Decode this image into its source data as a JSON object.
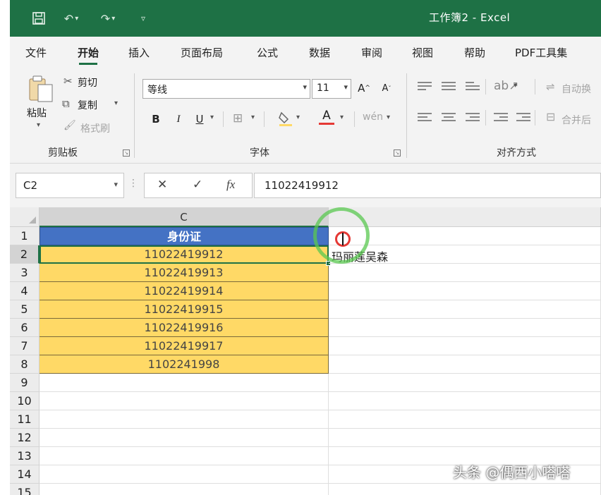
{
  "titlebar": {
    "title": "工作簿2 - Excel",
    "save_icon": "save-icon",
    "undo_icon": "undo-icon",
    "redo_icon": "redo-icon",
    "customize_icon": "customize-qat-icon"
  },
  "menu": {
    "tabs": [
      "文件",
      "开始",
      "插入",
      "页面布局",
      "公式",
      "数据",
      "审阅",
      "视图",
      "帮助",
      "PDF工具集"
    ],
    "active": "开始"
  },
  "ribbon": {
    "clipboard": {
      "paste_label": "粘贴",
      "cut_label": "剪切",
      "copy_label": "复制",
      "format_painter_label": "格式刷",
      "group_label": "剪贴板"
    },
    "font": {
      "font_name": "等线",
      "font_size": "11",
      "bold": "B",
      "italic": "I",
      "underline": "U",
      "grow": "A",
      "shrink": "A",
      "font_color": "A",
      "phonetic": "wén",
      "group_label": "字体"
    },
    "alignment": {
      "wrap_label": "自动换",
      "merge_label": "合并后",
      "group_label": "对齐方式"
    }
  },
  "formula_bar": {
    "name_box": "C2",
    "cancel": "✕",
    "enter": "✓",
    "fx": "fx",
    "value": "11022419912"
  },
  "sheet": {
    "selected_column": "C",
    "header_text": "身份证",
    "rows": [
      "1",
      "2",
      "3",
      "4",
      "5",
      "6",
      "7",
      "8",
      "9",
      "10",
      "11",
      "12",
      "13",
      "14",
      "15"
    ],
    "data": [
      "11022419912",
      "11022419913",
      "11022419914",
      "11022419915",
      "11022419916",
      "11022419917",
      "1102241998"
    ],
    "ghost_text": "玛丽莲吴森"
  },
  "watermark": "头条 @偶西小嗒嗒",
  "colors": {
    "excel_green": "#1e7145",
    "header_blue": "#4472c4",
    "data_yellow": "#ffd966"
  }
}
